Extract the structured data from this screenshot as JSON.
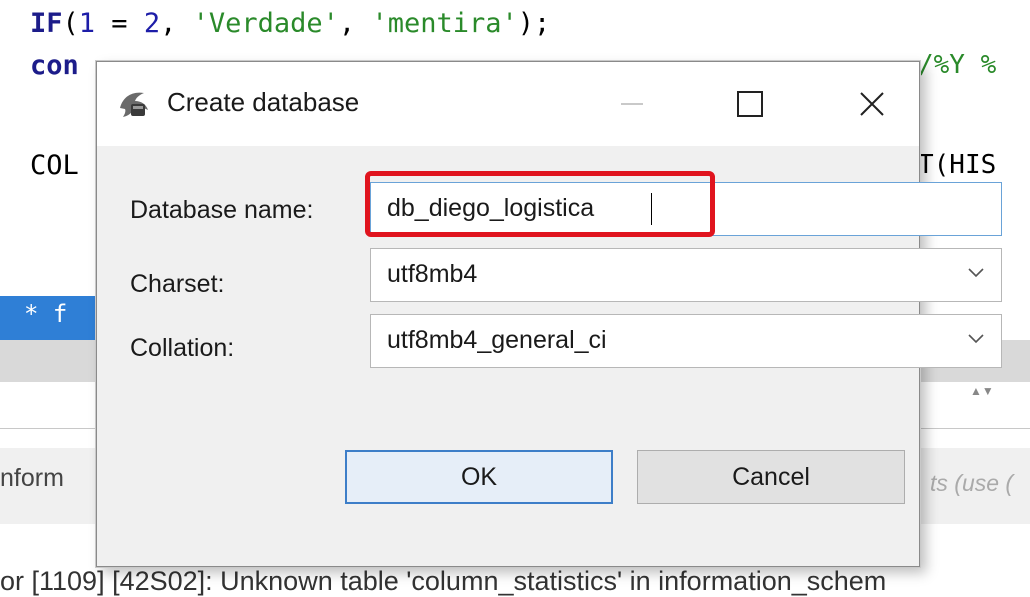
{
  "editor": {
    "line1": {
      "kw": "IF",
      "p1": "(",
      "n1": "1",
      "op": " = ",
      "n2": "2",
      "sep": ", ",
      "s1": "'Verdade'",
      "sep2": ", ",
      "s2": "'mentira'",
      "end": ");"
    },
    "line2_start": "con",
    "line2_end": "/%Y %",
    "line3_start": "COL",
    "line3_end": "T(HIS",
    "tab_fragment": "* f",
    "scroll_arrows": "▲▼",
    "info_fragment": "nform",
    "hint_fragment": "ts (use (",
    "error_line": "or [1109] [42S02]: Unknown table 'column_statistics' in information_schem"
  },
  "dialog": {
    "title": "Create database",
    "labels": {
      "name": "Database name:",
      "charset": "Charset:",
      "collation": "Collation:"
    },
    "values": {
      "name": "db_diego_logistica",
      "charset": "utf8mb4",
      "collation": "utf8mb4_general_ci"
    },
    "buttons": {
      "ok": "OK",
      "cancel": "Cancel"
    },
    "highlight_color": "#e0141e"
  }
}
